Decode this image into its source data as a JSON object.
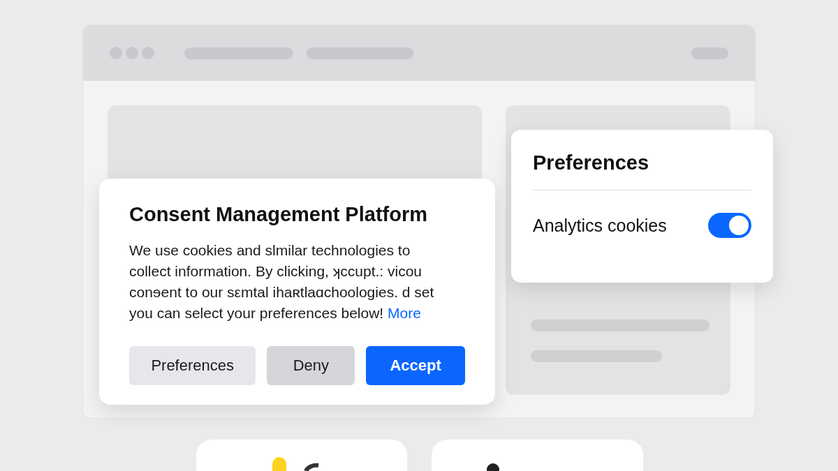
{
  "dialog": {
    "title": "Consent Management Platform",
    "body": "We use cookies and slmilar technologies to\ncollect information. By clicking, ʞccupt.: vicou\nconɘent to our sεmtal ihaʀtlaɑchoologies. d set\nyou can select your preferences below!",
    "link": "More",
    "buttons": [
      {
        "label": "Preferences",
        "kind": "secondary"
      },
      {
        "label": "Deny",
        "kind": "muted"
      },
      {
        "label": "Accept",
        "kind": "primary"
      }
    ]
  },
  "preferences": {
    "title": "Preferences",
    "items": [
      {
        "label": "Analytics cookies",
        "on": true
      }
    ]
  }
}
